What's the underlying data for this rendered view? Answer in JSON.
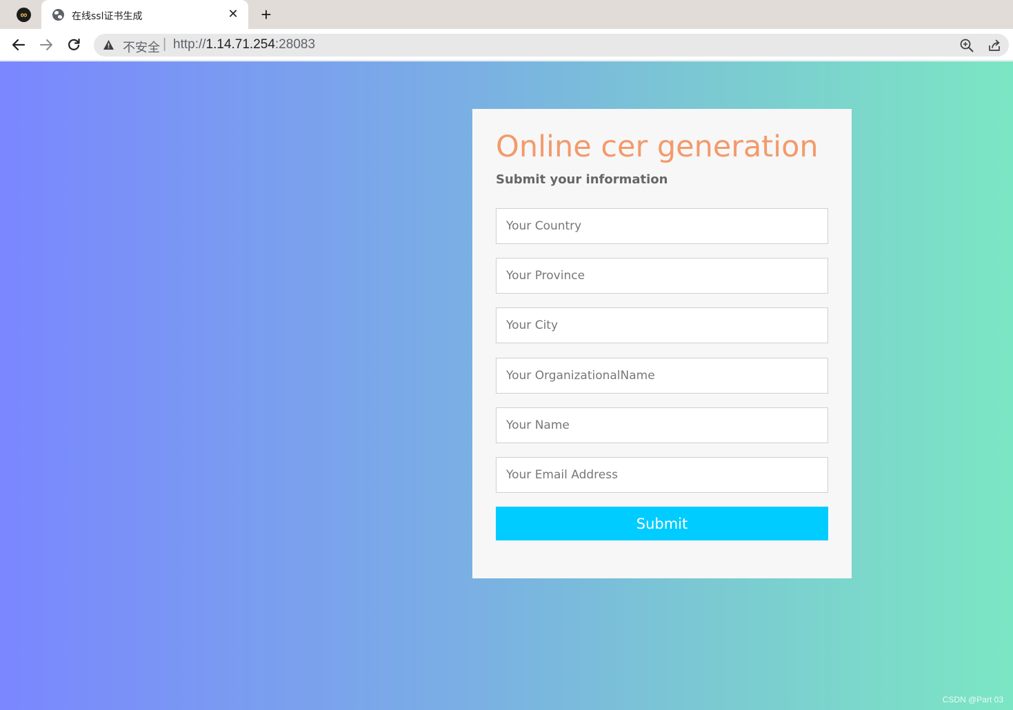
{
  "browser": {
    "app_icon": "∞",
    "tab": {
      "title": "在线ssl证书生成",
      "icon": "globe-icon",
      "close": "✕"
    },
    "new_tab": "+",
    "security_label": "不安全",
    "separator": "|",
    "url": {
      "scheme": "http://",
      "host": "1.14.71.254",
      "port": ":28083"
    }
  },
  "form": {
    "title": "Online cer generation",
    "subtitle": "Submit your information",
    "fields": {
      "country": "Your Country",
      "province": "Your Province",
      "city": "Your City",
      "organization": "Your OrganizationalName",
      "name": "Your Name",
      "email": "Your Email Address"
    },
    "submit_label": "Submit"
  },
  "watermark": "CSDN @Part 03",
  "colors": {
    "title": "#f39a6b",
    "submit_bg": "#00ccff",
    "gradient_left": "#7a87ff",
    "gradient_right": "#7be6c4"
  }
}
